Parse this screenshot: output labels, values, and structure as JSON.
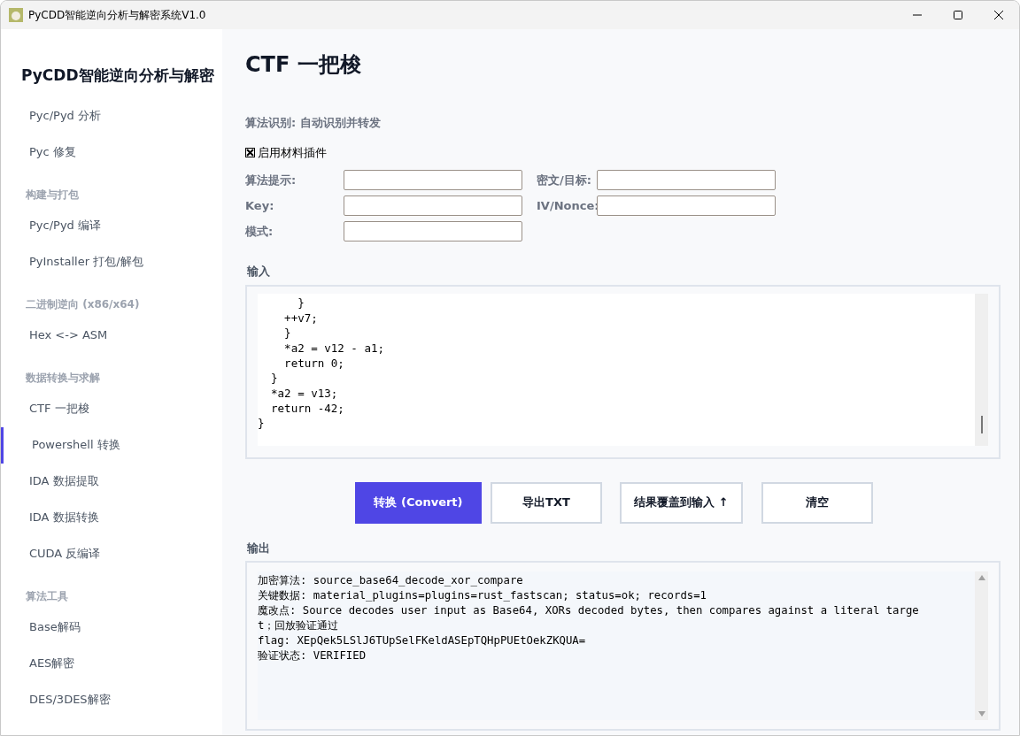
{
  "window": {
    "title": "PyCDD智能逆向分析与解密系统V1.0"
  },
  "sidebar": {
    "title": "PyCDD智能逆向分析与解密",
    "groups": [
      {
        "items": [
          {
            "label": "Pyc/Pyd 分析",
            "selected": false
          },
          {
            "label": "Pyc 修复",
            "selected": false
          }
        ]
      },
      {
        "heading": "构建与打包",
        "items": [
          {
            "label": "Pyc/Pyd 编译",
            "selected": false
          },
          {
            "label": "PyInstaller 打包/解包",
            "selected": false
          }
        ]
      },
      {
        "heading": "二进制逆向 (x86/x64)",
        "items": [
          {
            "label": "Hex <-> ASM",
            "selected": false
          }
        ]
      },
      {
        "heading": "数据转换与求解",
        "items": [
          {
            "label": "CTF 一把梭",
            "selected": false
          },
          {
            "label": "Powershell 转换",
            "selected": true
          },
          {
            "label": "IDA 数据提取",
            "selected": false
          },
          {
            "label": "IDA 数据转换",
            "selected": false
          },
          {
            "label": "CUDA 反编译",
            "selected": false
          }
        ]
      },
      {
        "heading": "算法工具",
        "items": [
          {
            "label": "Base解码",
            "selected": false
          },
          {
            "label": "AES解密",
            "selected": false
          },
          {
            "label": "DES/3DES解密",
            "selected": false
          }
        ]
      }
    ]
  },
  "page": {
    "title": "CTF 一把梭",
    "algorithm_status": "算法识别: 自动识别并转发",
    "plugin_checkbox": {
      "label": "启用材料插件",
      "checked": true
    },
    "fields": [
      {
        "label": "算法提示:"
      },
      {
        "label": "密文/目标:"
      },
      {
        "label": "Key:"
      },
      {
        "label": "IV/Nonce:"
      },
      {
        "label": "模式:"
      }
    ],
    "input": {
      "label": "输入",
      "lines": [
        "      }",
        "    ++v7;",
        "    }",
        "    *a2 = v12 - a1;",
        "    return 0;",
        "  }",
        "  *a2 = v13;",
        "  return -42;",
        "}"
      ]
    },
    "buttons": [
      {
        "label": "转换 (Convert)",
        "kind": "primary"
      },
      {
        "label": "导出TXT",
        "kind": "secondary"
      },
      {
        "label": "结果覆盖到输入 ↑",
        "kind": "secondary"
      },
      {
        "label": "清空",
        "kind": "secondary"
      }
    ],
    "output": {
      "label": "输出",
      "lines": [
        "加密算法: source_base64_decode_xor_compare",
        "关键数据: material_plugins=plugins=rust_fastscan; status=ok; records=1",
        "魔改点: Source decodes user input as Base64, XORs decoded bytes, then compares against a literal targe",
        "t；回放验证通过",
        "flag: XEpQek5LSlJ6TUpSelFKeldASEpTQHpPUEtOekZKQUA=",
        "验证状态: VERIFIED"
      ]
    }
  }
}
